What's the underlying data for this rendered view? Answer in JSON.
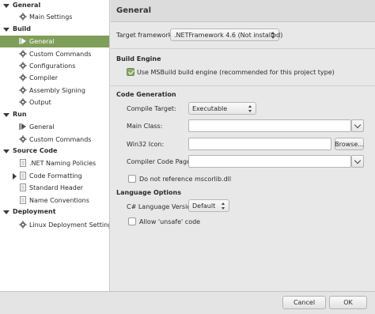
{
  "sidebar": {
    "general_section": "General",
    "main_settings": "Main Settings",
    "build_section": "Build",
    "build_items": [
      "General",
      "Custom Commands",
      "Configurations",
      "Compiler",
      "Assembly Signing",
      "Output"
    ],
    "run_section": "Run",
    "run_items": [
      "General",
      "Custom Commands"
    ],
    "source_code_section": "Source Code",
    "source_code_items": [
      ".NET Naming Policies",
      "Code Formatting",
      "Standard Header",
      "Name Conventions"
    ],
    "deployment_section": "Deployment",
    "deployment_items": [
      "Linux Deployment Settings"
    ],
    "selected_color": "#7f9e5a"
  },
  "main": {
    "title": "General",
    "target_framework_label": "Target framework:",
    "target_framework_value": ".NETFramework 4.6 (Not installed)",
    "build_engine_title": "Build Engine",
    "use_msbuild_label": "Use MSBuild build engine (recommended for this project type)",
    "use_msbuild_checked": true,
    "code_generation_title": "Code Generation",
    "compile_target_label": "Compile Target:",
    "compile_target_value": "Executable",
    "main_class_label": "Main Class:",
    "main_class_value": "",
    "win32_icon_label": "Win32 Icon:",
    "win32_icon_value": "",
    "browse_label": "Browse...",
    "compiler_code_page_label": "Compiler Code Page:",
    "compiler_code_page_value": "",
    "no_mscorlib_label": "Do not reference mscorlib.dll",
    "no_mscorlib_checked": false,
    "language_options_title": "Language Options",
    "csharp_version_label": "C# Language Version:",
    "csharp_version_value": "Default",
    "allow_unsafe_label": "Allow 'unsafe' code",
    "allow_unsafe_checked": false
  },
  "footer": {
    "cancel_label": "Cancel",
    "ok_label": "OK"
  }
}
